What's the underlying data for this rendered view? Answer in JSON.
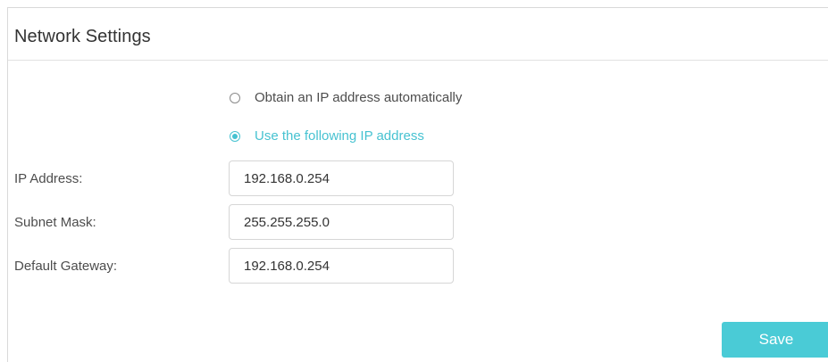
{
  "section": {
    "title": "Network Settings"
  },
  "ip_mode": {
    "options": [
      {
        "label": "Obtain an IP address automatically",
        "selected": false
      },
      {
        "label": "Use the following IP address",
        "selected": true
      }
    ]
  },
  "fields": {
    "ip_address": {
      "label": "IP Address:",
      "value": "192.168.0.254"
    },
    "subnet_mask": {
      "label": "Subnet Mask:",
      "value": "255.255.255.0"
    },
    "default_gateway": {
      "label": "Default Gateway:",
      "value": "192.168.0.254"
    }
  },
  "actions": {
    "save_label": "Save"
  },
  "colors": {
    "accent": "#46c2d1",
    "button": "#4acbd6",
    "text": "#4d4d4d"
  }
}
